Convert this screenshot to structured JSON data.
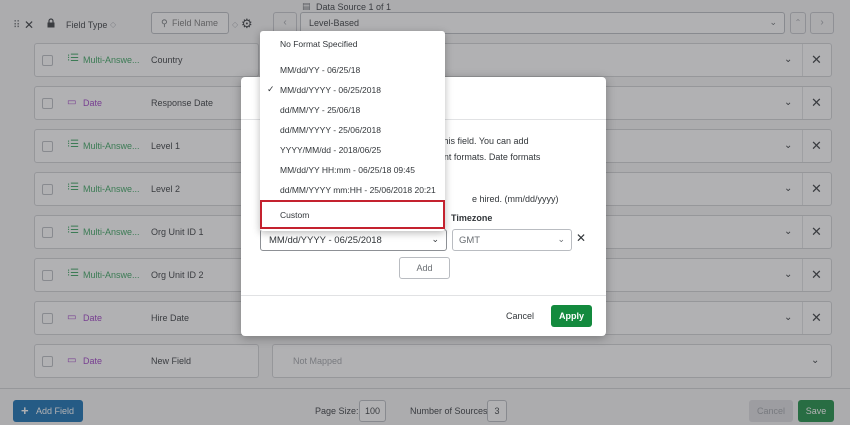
{
  "header": {
    "field_type_label": "Field Type",
    "field_name_placeholder": "Field Name",
    "data_source_label": "Data Source 1 of 1",
    "level_select_value": "Level-Based"
  },
  "rows": [
    {
      "type": "Multi-Answe...",
      "kind": "multi",
      "name": "Country"
    },
    {
      "type": "Date",
      "kind": "date",
      "name": "Response Date"
    },
    {
      "type": "Multi-Answe...",
      "kind": "multi",
      "name": "Level 1"
    },
    {
      "type": "Multi-Answe...",
      "kind": "multi",
      "name": "Level 2"
    },
    {
      "type": "Multi-Answe...",
      "kind": "multi",
      "name": "Org Unit ID 1"
    },
    {
      "type": "Multi-Answe...",
      "kind": "multi",
      "name": "Org Unit ID 2"
    },
    {
      "type": "Date",
      "kind": "date",
      "name": "Hire Date"
    },
    {
      "type": "Date",
      "kind": "date",
      "name": "New Field"
    }
  ],
  "last_row_mapping": "Not Mapped",
  "footer": {
    "add_field": "Add Field",
    "page_size_label": "Page Size:",
    "page_size_value": "100",
    "num_sources_label": "Number of Sources:",
    "num_sources_value": "3",
    "cancel": "Cancel",
    "save": "Save"
  },
  "modal": {
    "desc_line1": "rse this field. You can add",
    "desc_line2": "fferent formats. Date formats",
    "desc_line3": "e hired. (mm/dd/yyyy)",
    "timezone_label": "Timezone",
    "format_select_value": "MM/dd/YYYY - 06/25/2018",
    "timezone_value": "GMT",
    "add_button": "Add",
    "cancel": "Cancel",
    "apply": "Apply"
  },
  "dropdown": {
    "items": [
      {
        "label": "No Format Specified",
        "checked": false
      },
      {
        "label": "MM/dd/YY - 06/25/18",
        "checked": false
      },
      {
        "label": "MM/dd/YYYY - 06/25/2018",
        "checked": true
      },
      {
        "label": "dd/MM/YY - 25/06/18",
        "checked": false
      },
      {
        "label": "dd/MM/YYYY - 25/06/2018",
        "checked": false
      },
      {
        "label": "YYYY/MM/dd - 2018/06/25",
        "checked": false
      },
      {
        "label": "MM/dd/YY HH:mm - 06/25/18 09:45",
        "checked": false
      },
      {
        "label": "dd/MM/YYYY mm:HH - 25/06/2018 20:21",
        "checked": false
      },
      {
        "label": "Custom",
        "checked": false,
        "highlighted": true
      }
    ]
  },
  "colors": {
    "multi_answer": "#36a35d",
    "date": "#9c3ac4",
    "primary_blue": "#0f6bb0",
    "apply_green": "#138a3e",
    "highlight_red": "#c4222f"
  }
}
